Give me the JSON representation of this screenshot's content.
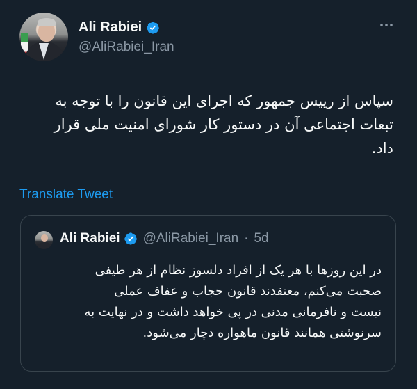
{
  "author": {
    "name": "Ali Rabiei",
    "handle": "@AliRabiei_Iran",
    "verified_badge_color": "#1d9bf0"
  },
  "tweet": {
    "text": "سپاس از رییس جمهور که اجرای این قانون را با توجه به\nتبعات اجتماعی آن در دستور کار شورای امنیت ملی قرار\nداد.",
    "translate_label": "Translate Tweet"
  },
  "quoted_tweet": {
    "name": "Ali Rabiei",
    "handle": "@AliRabiei_Iran",
    "separator": "·",
    "time": "5d",
    "text": "در این روزها با هر یک از افراد دلسوز نظام از هر طیفی\nصحبت می‌کنم، معتقدند قانون حجاب و عفاف عملی\nنیست و نافرمانی مدنی در پی خواهد داشت و در نهایت به\nسرنوشتی همانند قانون ماهواره دچار می‌شود."
  },
  "icons": {
    "more": "more-options-icon",
    "verified": "verified-badge-icon"
  },
  "colors": {
    "background": "#15202b",
    "text_primary": "#f7f9f9",
    "text_secondary": "#8b98a5",
    "link": "#1d9bf0",
    "border": "#38444d"
  }
}
